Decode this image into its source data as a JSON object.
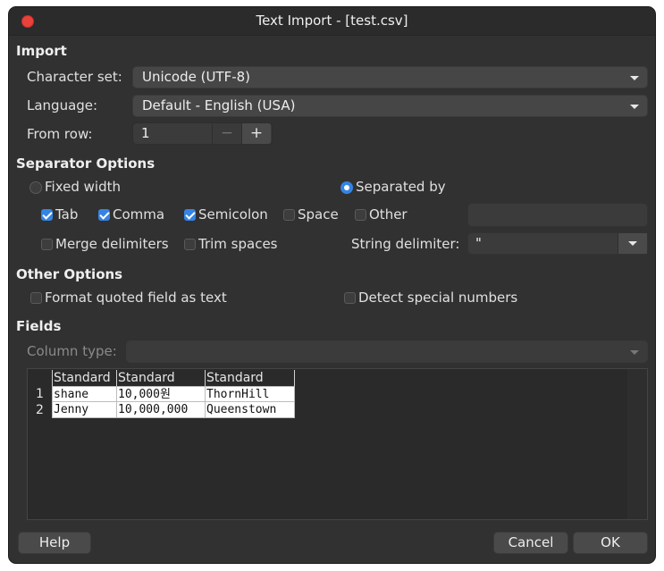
{
  "window": {
    "title": "Text Import - [test.csv]"
  },
  "import": {
    "section_title": "Import",
    "charset_label": "Character set:",
    "charset_value": "Unicode (UTF-8)",
    "language_label": "Language:",
    "language_value": "Default - English (USA)",
    "fromrow_label": "From row:",
    "fromrow_value": "1",
    "minus": "−",
    "plus": "+"
  },
  "separator": {
    "section_title": "Separator Options",
    "fixed_width": "Fixed width",
    "separated_by": "Separated by",
    "tab": "Tab",
    "comma": "Comma",
    "semicolon": "Semicolon",
    "space": "Space",
    "other": "Other",
    "merge": "Merge delimiters",
    "trim": "Trim spaces",
    "string_delim_label": "String delimiter:",
    "string_delim_value": "\""
  },
  "other_options": {
    "section_title": "Other Options",
    "format_quoted": "Format quoted field as text",
    "detect_special": "Detect special numbers"
  },
  "fields": {
    "section_title": "Fields",
    "column_type_label": "Column type:",
    "headers": [
      "Standard",
      "Standard",
      "Standard"
    ],
    "rows": [
      {
        "num": "1",
        "cells": [
          "shane",
          "10,000원",
          "ThornHill"
        ]
      },
      {
        "num": "2",
        "cells": [
          "Jenny",
          "10,000,000",
          "Queenstown"
        ]
      }
    ]
  },
  "buttons": {
    "help": "Help",
    "cancel": "Cancel",
    "ok": "OK"
  },
  "colors": {
    "accent": "#3584e4",
    "close": "#e9413b",
    "background": "#313131"
  }
}
